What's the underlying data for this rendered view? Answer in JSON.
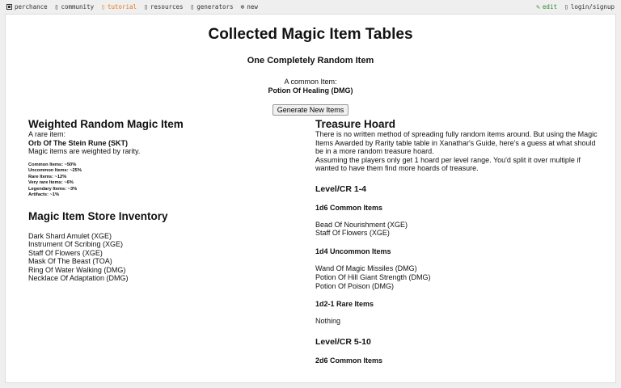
{
  "topnav": {
    "left": [
      {
        "label": "perchance",
        "icon": "logo-icon"
      },
      {
        "label": "community",
        "icon": "community-icon"
      },
      {
        "label": "tutorial",
        "icon": "tutorial-icon"
      },
      {
        "label": "resources",
        "icon": "resources-icon"
      },
      {
        "label": "generators",
        "icon": "generators-icon"
      },
      {
        "label": "new",
        "icon": "plus-icon"
      }
    ],
    "right": [
      {
        "label": "edit",
        "icon": "edit-icon"
      },
      {
        "label": "login/signup",
        "icon": "login-icon"
      }
    ],
    "active": "tutorial",
    "accent_color": "#e07a1e",
    "edit_color": "#2f8a3b"
  },
  "page": {
    "title": "Collected Magic Item Tables",
    "subtitle": "One Completely Random Item",
    "common_label": "A common Item:",
    "common_item": "Potion Of Healing (DMG)",
    "generate_button": "Generate New Items"
  },
  "weighted": {
    "heading": "Weighted Random Magic Item",
    "rare_label": "A rare item:",
    "rare_item": "Orb Of The Stein Rune (SKT)",
    "note": "Magic items are weighted by rarity.",
    "odds": [
      "Common Items: ~50%",
      "Uncommon Items: ~25%",
      "Rare Items: ~12%",
      "Very rare Items: ~6%",
      "Legendary Items: ~3%",
      "Artifacts: ~1%"
    ]
  },
  "store": {
    "heading": "Magic Item Store Inventory",
    "items": [
      "Dark Shard Amulet (XGE)",
      "Instrument Of Scribing (XGE)",
      "Staff Of Flowers (XGE)",
      "Mask Of The Beast (TOA)",
      "Ring Of Water Walking (DMG)",
      "Necklace Of Adaptation (DMG)"
    ]
  },
  "hoard": {
    "heading": "Treasure Hoard",
    "para1": "There is no written method of spreading fully random items around. But using the Magic Items Awarded by Rarity table table in Xanathar's Guide, here's a guess at what should be in a more random treasure hoard.",
    "para2": "Assuming the players only get 1 hoard per level range. You'd split it over multiple if wanted to have them find more hoards of treasure.",
    "level1": "Level/CR 1-4",
    "l1_common_heading": "1d6 Common Items",
    "l1_common": [
      "Bead Of Nourishment (XGE)",
      "Staff Of Flowers (XGE)"
    ],
    "l1_uncommon_heading": "1d4 Uncommon Items",
    "l1_uncommon": [
      "Wand Of Magic Missiles (DMG)",
      "Potion Of Hill Giant Strength (DMG)",
      "Potion Of Poison (DMG)"
    ],
    "l1_rare_heading": "1d2-1 Rare Items",
    "l1_rare": [
      "Nothing"
    ],
    "level2": "Level/CR 5-10",
    "l2_common_heading": "2d6 Common Items"
  }
}
